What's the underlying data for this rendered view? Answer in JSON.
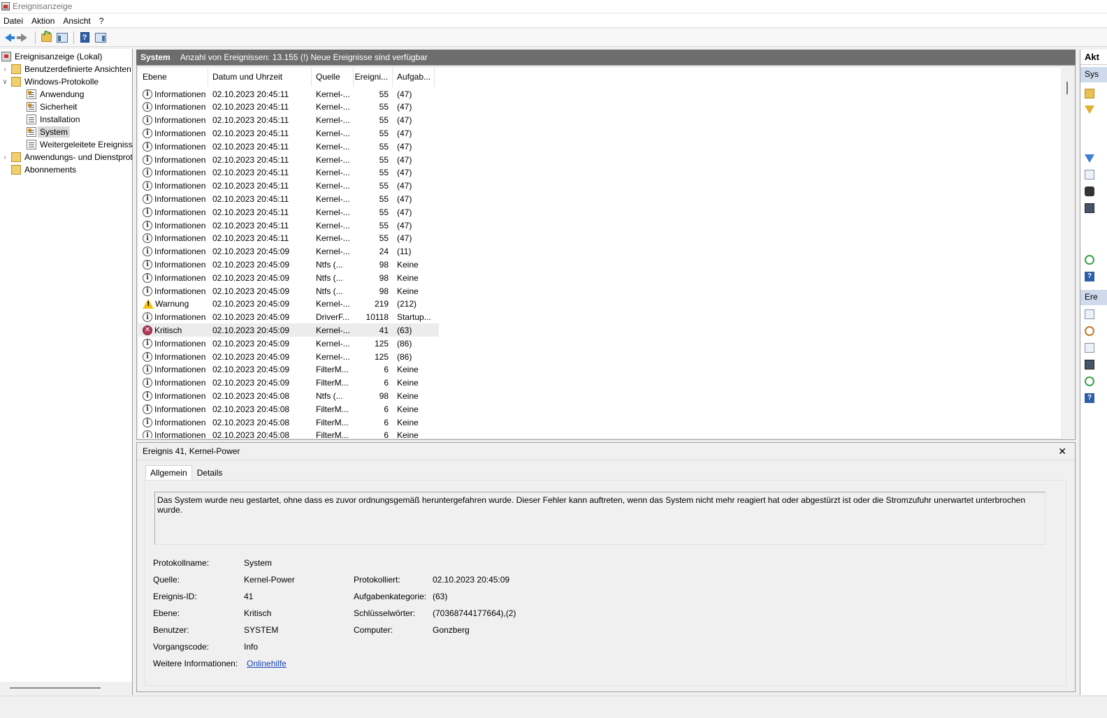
{
  "window": {
    "title": "Ereignisanzeige"
  },
  "menu": [
    "Datei",
    "Aktion",
    "Ansicht",
    "?"
  ],
  "tree": {
    "root": "Ereignisanzeige (Lokal)",
    "custom_views": "Benutzerdefinierte Ansichten",
    "windows_logs": "Windows-Protokolle",
    "logs": [
      "Anwendung",
      "Sicherheit",
      "Installation",
      "System",
      "Weitergeleitete Ereignisse"
    ],
    "selected": "System",
    "app_services": "Anwendungs- und Dienstprotokolle",
    "subscriptions": "Abonnements"
  },
  "center": {
    "title": "System",
    "info": "Anzahl von Ereignissen: 13.155 (!) Neue Ereignisse sind verfügbar"
  },
  "grid": {
    "columns": [
      "Ebene",
      "Datum und Uhrzeit",
      "Quelle",
      "Ereigni...",
      "Aufgab..."
    ],
    "rows": [
      {
        "level": "Informationen",
        "type": "info",
        "date": "02.10.2023 20:45:11",
        "source": "Kernel-...",
        "id": "55",
        "task": "(47)"
      },
      {
        "level": "Informationen",
        "type": "info",
        "date": "02.10.2023 20:45:11",
        "source": "Kernel-...",
        "id": "55",
        "task": "(47)"
      },
      {
        "level": "Informationen",
        "type": "info",
        "date": "02.10.2023 20:45:11",
        "source": "Kernel-...",
        "id": "55",
        "task": "(47)"
      },
      {
        "level": "Informationen",
        "type": "info",
        "date": "02.10.2023 20:45:11",
        "source": "Kernel-...",
        "id": "55",
        "task": "(47)"
      },
      {
        "level": "Informationen",
        "type": "info",
        "date": "02.10.2023 20:45:11",
        "source": "Kernel-...",
        "id": "55",
        "task": "(47)"
      },
      {
        "level": "Informationen",
        "type": "info",
        "date": "02.10.2023 20:45:11",
        "source": "Kernel-...",
        "id": "55",
        "task": "(47)"
      },
      {
        "level": "Informationen",
        "type": "info",
        "date": "02.10.2023 20:45:11",
        "source": "Kernel-...",
        "id": "55",
        "task": "(47)"
      },
      {
        "level": "Informationen",
        "type": "info",
        "date": "02.10.2023 20:45:11",
        "source": "Kernel-...",
        "id": "55",
        "task": "(47)"
      },
      {
        "level": "Informationen",
        "type": "info",
        "date": "02.10.2023 20:45:11",
        "source": "Kernel-...",
        "id": "55",
        "task": "(47)"
      },
      {
        "level": "Informationen",
        "type": "info",
        "date": "02.10.2023 20:45:11",
        "source": "Kernel-...",
        "id": "55",
        "task": "(47)"
      },
      {
        "level": "Informationen",
        "type": "info",
        "date": "02.10.2023 20:45:11",
        "source": "Kernel-...",
        "id": "55",
        "task": "(47)"
      },
      {
        "level": "Informationen",
        "type": "info",
        "date": "02.10.2023 20:45:11",
        "source": "Kernel-...",
        "id": "55",
        "task": "(47)"
      },
      {
        "level": "Informationen",
        "type": "info",
        "date": "02.10.2023 20:45:09",
        "source": "Kernel-...",
        "id": "24",
        "task": "(11)"
      },
      {
        "level": "Informationen",
        "type": "info",
        "date": "02.10.2023 20:45:09",
        "source": "Ntfs (...",
        "id": "98",
        "task": "Keine"
      },
      {
        "level": "Informationen",
        "type": "info",
        "date": "02.10.2023 20:45:09",
        "source": "Ntfs (...",
        "id": "98",
        "task": "Keine"
      },
      {
        "level": "Informationen",
        "type": "info",
        "date": "02.10.2023 20:45:09",
        "source": "Ntfs (...",
        "id": "98",
        "task": "Keine"
      },
      {
        "level": "Warnung",
        "type": "warn",
        "date": "02.10.2023 20:45:09",
        "source": "Kernel-...",
        "id": "219",
        "task": "(212)"
      },
      {
        "level": "Informationen",
        "type": "info",
        "date": "02.10.2023 20:45:09",
        "source": "DriverF...",
        "id": "10118",
        "task": "Startup..."
      },
      {
        "level": "Kritisch",
        "type": "crit",
        "date": "02.10.2023 20:45:09",
        "source": "Kernel-...",
        "id": "41",
        "task": "(63)",
        "selected": true
      },
      {
        "level": "Informationen",
        "type": "info",
        "date": "02.10.2023 20:45:09",
        "source": "Kernel-...",
        "id": "125",
        "task": "(86)"
      },
      {
        "level": "Informationen",
        "type": "info",
        "date": "02.10.2023 20:45:09",
        "source": "Kernel-...",
        "id": "125",
        "task": "(86)"
      },
      {
        "level": "Informationen",
        "type": "info",
        "date": "02.10.2023 20:45:09",
        "source": "FilterM...",
        "id": "6",
        "task": "Keine"
      },
      {
        "level": "Informationen",
        "type": "info",
        "date": "02.10.2023 20:45:09",
        "source": "FilterM...",
        "id": "6",
        "task": "Keine"
      },
      {
        "level": "Informationen",
        "type": "info",
        "date": "02.10.2023 20:45:08",
        "source": "Ntfs (...",
        "id": "98",
        "task": "Keine"
      },
      {
        "level": "Informationen",
        "type": "info",
        "date": "02.10.2023 20:45:08",
        "source": "FilterM...",
        "id": "6",
        "task": "Keine"
      },
      {
        "level": "Informationen",
        "type": "info",
        "date": "02.10.2023 20:45:08",
        "source": "FilterM...",
        "id": "6",
        "task": "Keine"
      },
      {
        "level": "Informationen",
        "type": "info",
        "date": "02.10.2023 20:45:08",
        "source": "FilterM...",
        "id": "6",
        "task": "Keine"
      }
    ]
  },
  "detail": {
    "title": "Ereignis 41, Kernel-Power",
    "close": "✕",
    "tabs": [
      "Allgemein",
      "Details"
    ],
    "message": "Das System wurde neu gestartet, ohne dass es zuvor ordnungsgemäß heruntergefahren wurde. Dieser Fehler kann auftreten, wenn das System nicht mehr reagiert hat oder abgestürzt ist oder die Stromzufuhr unerwartet unterbrochen wurde.",
    "props": {
      "log_name_label": "Protokollname:",
      "log_name": "System",
      "source_label": "Quelle:",
      "source": "Kernel-Power",
      "event_id_label": "Ereignis-ID:",
      "event_id": "41",
      "level_label": "Ebene:",
      "level": "Kritisch",
      "user_label": "Benutzer:",
      "user": "SYSTEM",
      "opcode_label": "Vorgangscode:",
      "opcode": "Info",
      "more_info_label": "Weitere Informationen:",
      "more_info_link": "Onlinehilfe",
      "logged_label": "Protokolliert:",
      "logged": "02.10.2023 20:45:09",
      "task_cat_label": "Aufgabenkategorie:",
      "task_cat": "(63)",
      "keywords_label": "Schlüsselwörter:",
      "keywords": "(70368744177664),(2)",
      "computer_label": "Computer:",
      "computer": "Gonzberg"
    }
  },
  "actions": {
    "title": "Akt",
    "section1": "Sys",
    "section2": "Ere"
  }
}
